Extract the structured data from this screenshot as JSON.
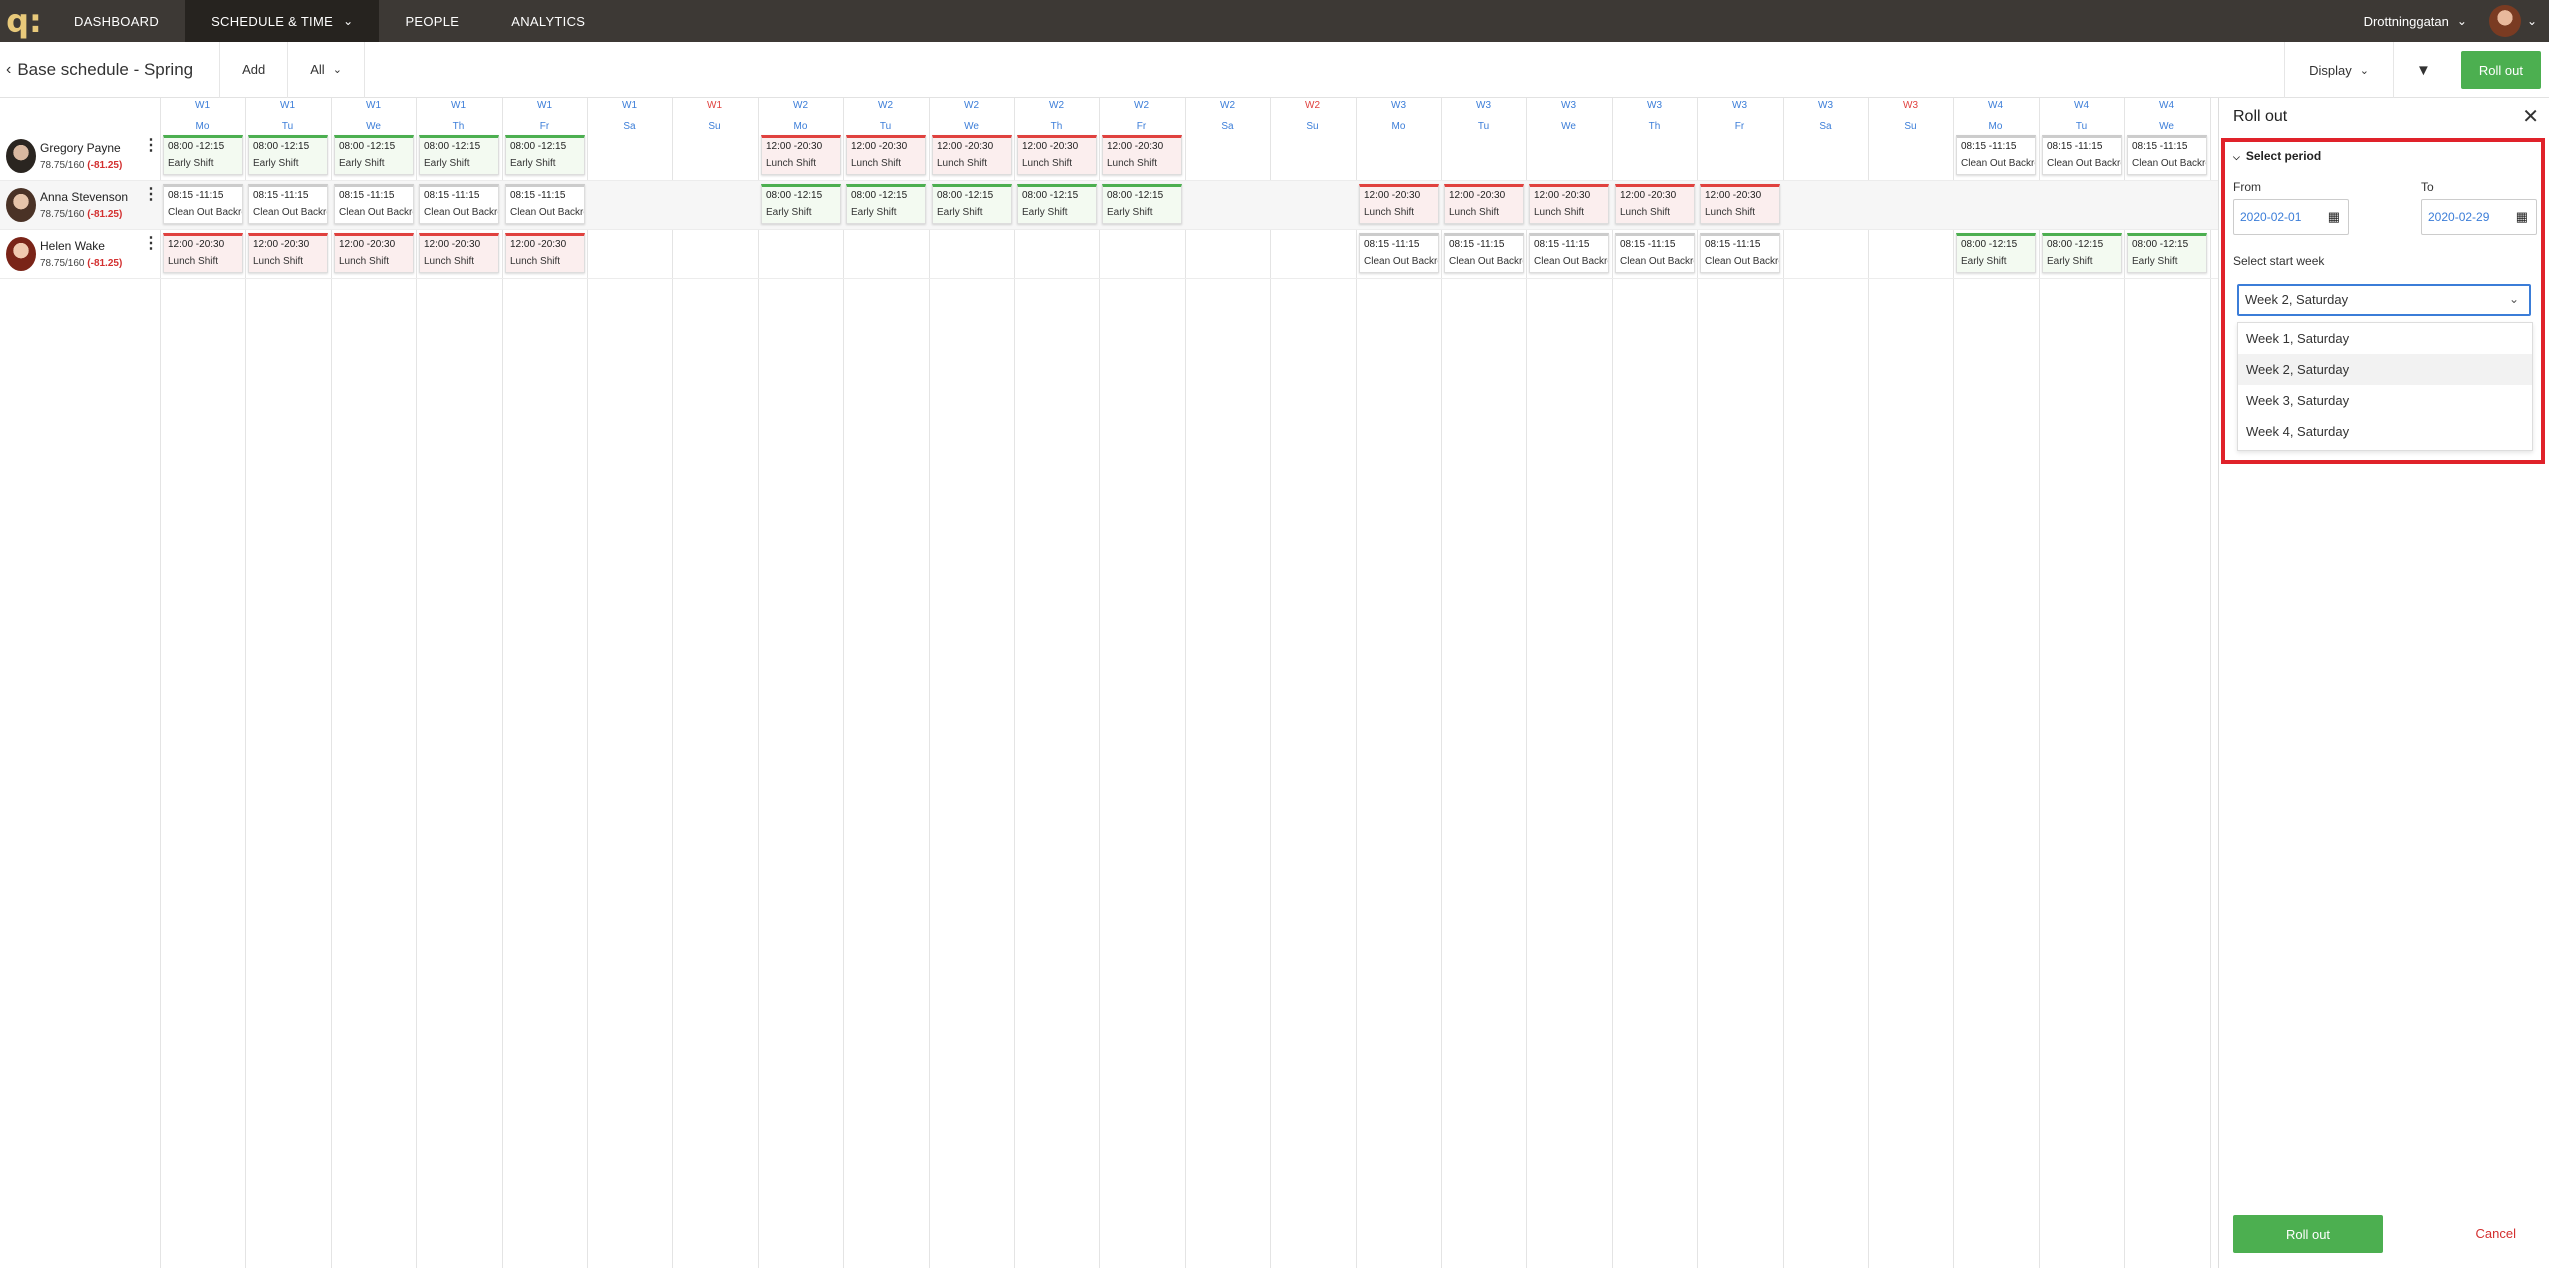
{
  "nav": {
    "logo": "q:",
    "items": [
      "DASHBOARD",
      "SCHEDULE & TIME",
      "PEOPLE",
      "ANALYTICS"
    ],
    "location": "Drottninggatan"
  },
  "toolbar": {
    "title": "Base schedule - Spring",
    "add_label": "Add",
    "all_label": "All",
    "display_label": "Display",
    "rollout_label": "Roll out"
  },
  "days": [
    {
      "w": "W1",
      "d": "Mo"
    },
    {
      "w": "W1",
      "d": "Tu"
    },
    {
      "w": "W1",
      "d": "We"
    },
    {
      "w": "W1",
      "d": "Th"
    },
    {
      "w": "W1",
      "d": "Fr"
    },
    {
      "w": "W1",
      "d": "Sa"
    },
    {
      "w": "W1",
      "d": "Su"
    },
    {
      "w": "W2",
      "d": "Mo"
    },
    {
      "w": "W2",
      "d": "Tu"
    },
    {
      "w": "W2",
      "d": "We"
    },
    {
      "w": "W2",
      "d": "Th"
    },
    {
      "w": "W2",
      "d": "Fr"
    },
    {
      "w": "W2",
      "d": "Sa"
    },
    {
      "w": "W2",
      "d": "Su"
    },
    {
      "w": "W3",
      "d": "Mo"
    },
    {
      "w": "W3",
      "d": "Tu"
    },
    {
      "w": "W3",
      "d": "We"
    },
    {
      "w": "W3",
      "d": "Th"
    },
    {
      "w": "W3",
      "d": "Fr"
    },
    {
      "w": "W3",
      "d": "Sa"
    },
    {
      "w": "W3",
      "d": "Su"
    },
    {
      "w": "W4",
      "d": "Mo"
    },
    {
      "w": "W4",
      "d": "Tu"
    },
    {
      "w": "W4",
      "d": "We"
    }
  ],
  "people": [
    {
      "name": "Gregory Payne",
      "hours": "78.75/160",
      "diff": "(-81.25)"
    },
    {
      "name": "Anna Stevenson",
      "hours": "78.75/160",
      "diff": "(-81.25)"
    },
    {
      "name": "Helen Wake",
      "hours": "78.75/160",
      "diff": "(-81.25)"
    }
  ],
  "shifts": [
    {
      "row": 0,
      "day": 0,
      "time": "08:00 -12:15",
      "name": "Early Shift",
      "color": "green"
    },
    {
      "row": 0,
      "day": 1,
      "time": "08:00 -12:15",
      "name": "Early Shift",
      "color": "green"
    },
    {
      "row": 0,
      "day": 2,
      "time": "08:00 -12:15",
      "name": "Early Shift",
      "color": "green"
    },
    {
      "row": 0,
      "day": 3,
      "time": "08:00 -12:15",
      "name": "Early Shift",
      "color": "green"
    },
    {
      "row": 0,
      "day": 4,
      "time": "08:00 -12:15",
      "name": "Early Shift",
      "color": "green"
    },
    {
      "row": 0,
      "day": 7,
      "time": "12:00 -20:30",
      "name": "Lunch Shift",
      "color": "red"
    },
    {
      "row": 0,
      "day": 8,
      "time": "12:00 -20:30",
      "name": "Lunch Shift",
      "color": "red"
    },
    {
      "row": 0,
      "day": 9,
      "time": "12:00 -20:30",
      "name": "Lunch Shift",
      "color": "red"
    },
    {
      "row": 0,
      "day": 10,
      "time": "12:00 -20:30",
      "name": "Lunch Shift",
      "color": "red"
    },
    {
      "row": 0,
      "day": 11,
      "time": "12:00 -20:30",
      "name": "Lunch Shift",
      "color": "red"
    },
    {
      "row": 0,
      "day": 21,
      "time": "08:15 -11:15",
      "name": "Clean Out Backroom",
      "color": "gray"
    },
    {
      "row": 0,
      "day": 22,
      "time": "08:15 -11:15",
      "name": "Clean Out Backroom",
      "color": "gray"
    },
    {
      "row": 0,
      "day": 23,
      "time": "08:15 -11:15",
      "name": "Clean Out Backroom",
      "color": "gray"
    },
    {
      "row": 1,
      "day": 0,
      "time": "08:15 -11:15",
      "name": "Clean Out Backroom",
      "color": "gray"
    },
    {
      "row": 1,
      "day": 1,
      "time": "08:15 -11:15",
      "name": "Clean Out Backroom",
      "color": "gray"
    },
    {
      "row": 1,
      "day": 2,
      "time": "08:15 -11:15",
      "name": "Clean Out Backroom",
      "color": "gray"
    },
    {
      "row": 1,
      "day": 3,
      "time": "08:15 -11:15",
      "name": "Clean Out Backroom",
      "color": "gray"
    },
    {
      "row": 1,
      "day": 4,
      "time": "08:15 -11:15",
      "name": "Clean Out Backroom",
      "color": "gray"
    },
    {
      "row": 1,
      "day": 7,
      "time": "08:00 -12:15",
      "name": "Early Shift",
      "color": "green"
    },
    {
      "row": 1,
      "day": 8,
      "time": "08:00 -12:15",
      "name": "Early Shift",
      "color": "green"
    },
    {
      "row": 1,
      "day": 9,
      "time": "08:00 -12:15",
      "name": "Early Shift",
      "color": "green"
    },
    {
      "row": 1,
      "day": 10,
      "time": "08:00 -12:15",
      "name": "Early Shift",
      "color": "green"
    },
    {
      "row": 1,
      "day": 11,
      "time": "08:00 -12:15",
      "name": "Early Shift",
      "color": "green"
    },
    {
      "row": 1,
      "day": 14,
      "time": "12:00 -20:30",
      "name": "Lunch Shift",
      "color": "red"
    },
    {
      "row": 1,
      "day": 15,
      "time": "12:00 -20:30",
      "name": "Lunch Shift",
      "color": "red"
    },
    {
      "row": 1,
      "day": 16,
      "time": "12:00 -20:30",
      "name": "Lunch Shift",
      "color": "red"
    },
    {
      "row": 1,
      "day": 17,
      "time": "12:00 -20:30",
      "name": "Lunch Shift",
      "color": "red"
    },
    {
      "row": 1,
      "day": 18,
      "time": "12:00 -20:30",
      "name": "Lunch Shift",
      "color": "red"
    },
    {
      "row": 2,
      "day": 0,
      "time": "12:00 -20:30",
      "name": "Lunch Shift",
      "color": "red"
    },
    {
      "row": 2,
      "day": 1,
      "time": "12:00 -20:30",
      "name": "Lunch Shift",
      "color": "red"
    },
    {
      "row": 2,
      "day": 2,
      "time": "12:00 -20:30",
      "name": "Lunch Shift",
      "color": "red"
    },
    {
      "row": 2,
      "day": 3,
      "time": "12:00 -20:30",
      "name": "Lunch Shift",
      "color": "red"
    },
    {
      "row": 2,
      "day": 4,
      "time": "12:00 -20:30",
      "name": "Lunch Shift",
      "color": "red"
    },
    {
      "row": 2,
      "day": 14,
      "time": "08:15 -11:15",
      "name": "Clean Out Backroom",
      "color": "gray"
    },
    {
      "row": 2,
      "day": 15,
      "time": "08:15 -11:15",
      "name": "Clean Out Backroom",
      "color": "gray"
    },
    {
      "row": 2,
      "day": 16,
      "time": "08:15 -11:15",
      "name": "Clean Out Backroom",
      "color": "gray"
    },
    {
      "row": 2,
      "day": 17,
      "time": "08:15 -11:15",
      "name": "Clean Out Backroom",
      "color": "gray"
    },
    {
      "row": 2,
      "day": 18,
      "time": "08:15 -11:15",
      "name": "Clean Out Backroom",
      "color": "gray"
    },
    {
      "row": 2,
      "day": 21,
      "time": "08:00 -12:15",
      "name": "Early Shift",
      "color": "green"
    },
    {
      "row": 2,
      "day": 22,
      "time": "08:00 -12:15",
      "name": "Early Shift",
      "color": "green"
    },
    {
      "row": 2,
      "day": 23,
      "time": "08:00 -12:15",
      "name": "Early Shift",
      "color": "green"
    }
  ],
  "panel": {
    "title": "Roll out",
    "section_title": "Select period",
    "from_label": "From",
    "from_value": "2020-02-01",
    "to_label": "To",
    "to_value": "2020-02-29",
    "start_week_label": "Select start week",
    "selected_week": "Week 2, Saturday",
    "options": [
      "Week 1, Saturday",
      "Week 2, Saturday",
      "Week 3, Saturday",
      "Week 4, Saturday"
    ],
    "rollout_button": "Roll out",
    "cancel_button": "Cancel"
  },
  "colors": {
    "accent": "#4caf50",
    "negative": "#d32f2f",
    "link": "#3b7dd8",
    "highlight": "#e0222a"
  }
}
